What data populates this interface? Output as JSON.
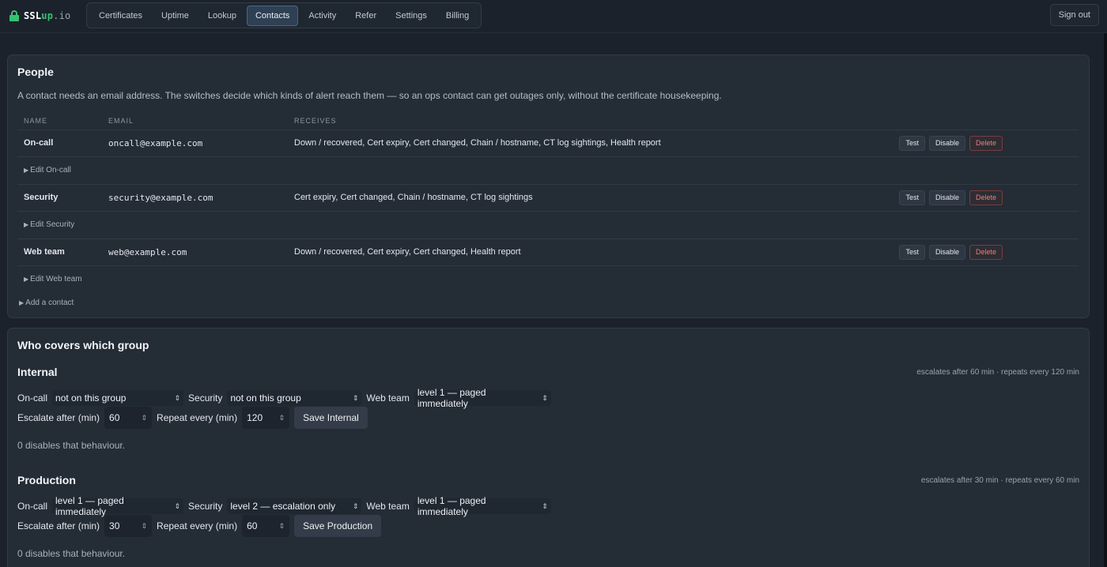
{
  "brand": {
    "name": "SSL",
    "name_up": "up",
    "name_tld": ".io"
  },
  "nav": {
    "items": [
      "Certificates",
      "Uptime",
      "Lookup",
      "Contacts",
      "Activity",
      "Refer",
      "Settings",
      "Billing"
    ],
    "active": "Contacts",
    "sign_out": "Sign out"
  },
  "people": {
    "title": "People",
    "intro": "A contact needs an email address. The switches decide which kinds of alert reach them — so an ops contact can get outages only, without the certificate housekeeping.",
    "columns": [
      "NAME",
      "EMAIL",
      "RECEIVES"
    ],
    "contacts": [
      {
        "name": "On-call",
        "email": "oncall@example.com",
        "receives": "Down / recovered, Cert expiry, Cert changed, Chain / hostname, CT log sightings, Health report",
        "edit": "Edit On-call"
      },
      {
        "name": "Security",
        "email": "security@example.com",
        "receives": "Cert expiry, Cert changed, Chain / hostname, CT log sightings",
        "edit": "Edit Security"
      },
      {
        "name": "Web team",
        "email": "web@example.com",
        "receives": "Down / recovered, Cert expiry, Cert changed, Health report",
        "edit": "Edit Web team"
      }
    ],
    "actions": {
      "test": "Test",
      "disable": "Disable",
      "delete": "Delete"
    },
    "add_contact": "Add a contact"
  },
  "groups": {
    "title": "Who covers which group",
    "labels": {
      "escalate": "Escalate after (min)",
      "repeat": "Repeat every (min)",
      "note": "0 disables that behaviour."
    },
    "items": [
      {
        "name": "Internal",
        "meta": "escalates after 60 min · repeats every 120 min",
        "assignments": [
          {
            "contact": "On-call",
            "value": "not on this group"
          },
          {
            "contact": "Security",
            "value": "not on this group"
          },
          {
            "contact": "Web team",
            "value": "level 1 — paged immediately"
          }
        ],
        "escalate": "60",
        "repeat": "120",
        "save": "Save Internal"
      },
      {
        "name": "Production",
        "meta": "escalates after 30 min · repeats every 60 min",
        "assignments": [
          {
            "contact": "On-call",
            "value": "level 1 — paged immediately"
          },
          {
            "contact": "Security",
            "value": "level 2 — escalation only"
          },
          {
            "contact": "Web team",
            "value": "level 1 — paged immediately"
          }
        ],
        "escalate": "30",
        "repeat": "60",
        "save": "Save Production"
      }
    ]
  },
  "colors": {
    "accent_green": "#38c172",
    "active_tab": "#2f4054",
    "danger": "#ea7f7b",
    "background": "#1b222b",
    "card": "#242c36"
  }
}
